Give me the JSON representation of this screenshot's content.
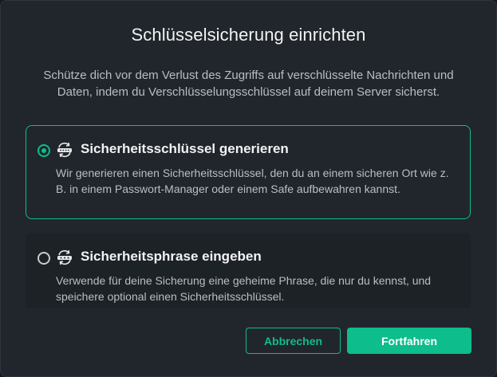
{
  "dialog": {
    "title": "Schlüsselsicherung einrichten",
    "description": "Schütze dich vor dem Verlust des Zugriffs auf verschlüsselte Nachrichten und Daten, indem du Verschlüsselungsschlüssel auf deinem Server sicherst."
  },
  "options": [
    {
      "title": "Sicherheitsschlüssel generieren",
      "body": "Wir generieren einen Sicherheitsschlüssel, den du an einem sicheren Ort wie z. B. in einem Passwort-Manager oder einem Safe aufbewahren kannst.",
      "selected": true,
      "icon": "key-generate-icon"
    },
    {
      "title": "Sicherheitsphrase eingeben",
      "body": "Verwende für deine Sicherung eine geheime Phrase, die nur du kennst, und speichere optional einen Sicherheitsschlüssel.",
      "selected": false,
      "icon": "passphrase-icon"
    }
  ],
  "buttons": {
    "cancel_label": "Abbrechen",
    "continue_label": "Fortfahren"
  },
  "colors": {
    "accent": "#0dbd8b",
    "dialog_bg": "#21262c",
    "text_primary": "#f2f3f4",
    "text_secondary": "#b8bec5"
  }
}
